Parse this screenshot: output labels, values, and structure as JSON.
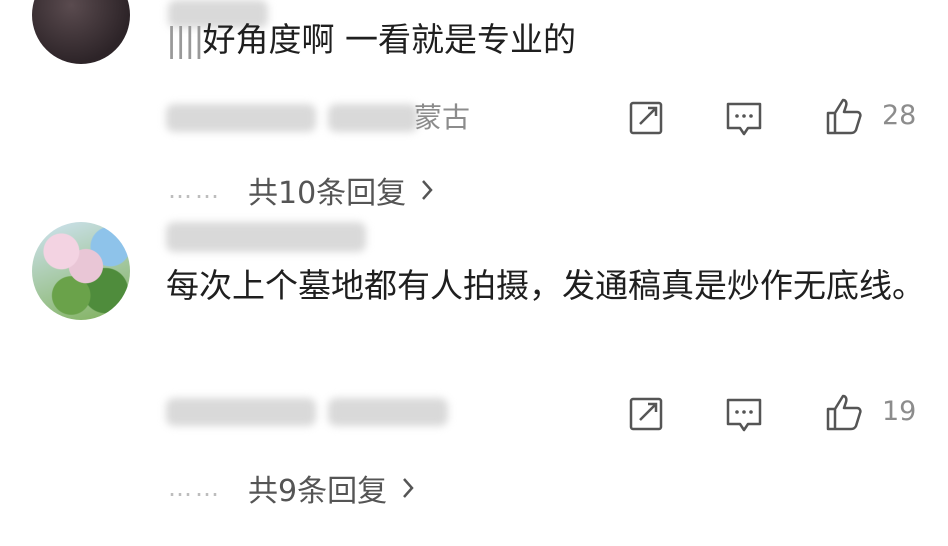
{
  "comments": [
    {
      "text_mask": "||||",
      "text": "好角度啊 一看就是专业的",
      "location": "蒙古",
      "likes": "28",
      "replies_label": "共10条回复"
    },
    {
      "text": "每次上个墓地都有人拍摄，发通稿真是炒作无底线。",
      "likes": "19",
      "replies_label": "共9条回复"
    }
  ],
  "reply_dots": "……",
  "icons": [
    "share-icon",
    "comment-icon",
    "like-icon",
    "chevron-right-icon"
  ]
}
